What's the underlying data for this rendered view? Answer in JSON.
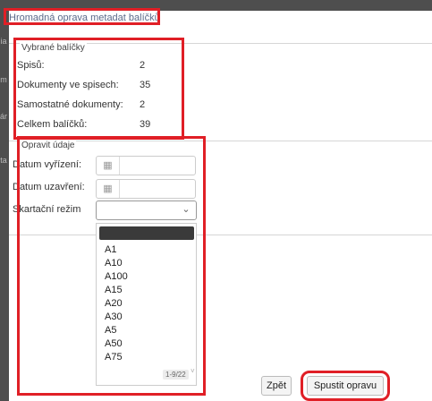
{
  "dialog": {
    "title": "Hromadná oprava metadat balíčků"
  },
  "summary": {
    "legend": "Vybrané balíčky",
    "rows": [
      {
        "label": "Spisů:",
        "value": "2"
      },
      {
        "label": "Dokumenty ve spisech:",
        "value": "35"
      },
      {
        "label": "Samostatné dokumenty:",
        "value": "2"
      },
      {
        "label": "Celkem balíčků:",
        "value": "39"
      }
    ]
  },
  "fix": {
    "legend": "Opravit údaje",
    "datum_vyrizeni_label": "Datum vyřízení:",
    "datum_uzavreni_label": "Datum uzavření:",
    "skartacni_label": "Skartační režim",
    "calendar_icon": "calendar-icon",
    "options": [
      "A1",
      "A10",
      "A100",
      "A15",
      "A20",
      "A30",
      "A5",
      "A50",
      "A75"
    ],
    "pager": "1-9/22"
  },
  "footer": {
    "back_label": "Zpět",
    "run_label": "Spustit opravu"
  },
  "colors": {
    "highlight_border": "#e01f26",
    "title_text": "#5b6a8a",
    "selected_option": "#3a3a3a"
  }
}
